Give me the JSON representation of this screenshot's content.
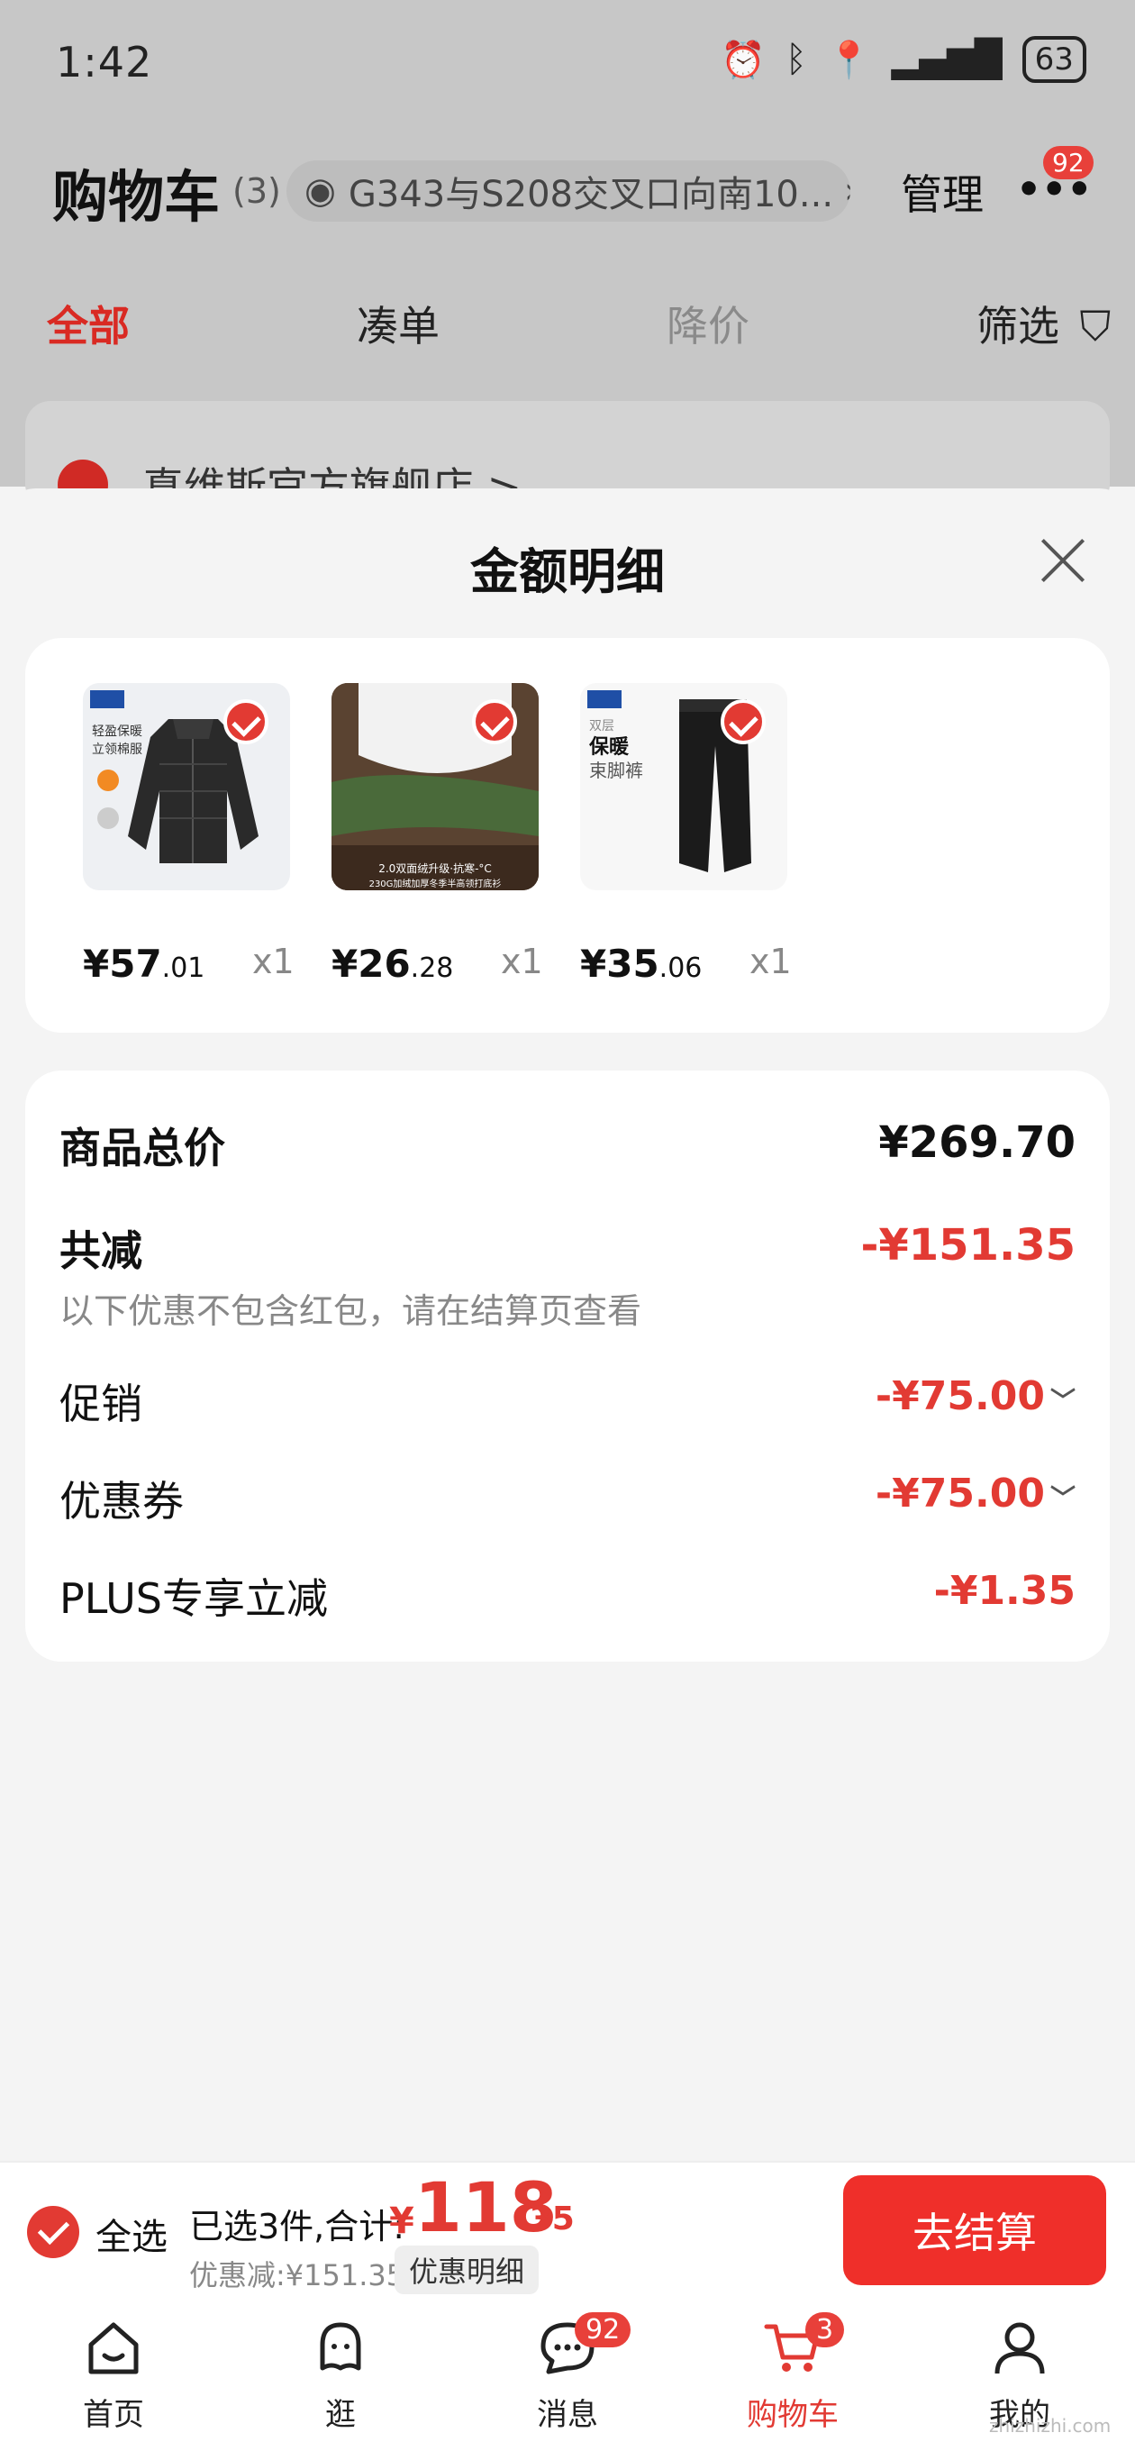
{
  "status_bar": {
    "time": "1:42",
    "battery": "63"
  },
  "header": {
    "title": "购物车",
    "count": "(3)",
    "address": "G343与S208交叉口向南10...",
    "manage": "管理",
    "more_badge": "92"
  },
  "tabs": [
    {
      "label": "全部"
    },
    {
      "label": "凑单"
    },
    {
      "label": "降价"
    },
    {
      "label": "筛选"
    }
  ],
  "store": {
    "name": "真维斯官方旗舰店 >"
  },
  "sheet": {
    "title": "金额明细",
    "items": [
      {
        "name": "轻盈保暖立领棉服",
        "price_int": "¥57",
        "price_dec": ".01",
        "qty": "x1"
      },
      {
        "name": "2.0双面绒升级·抗寒-°C 230G加绒加厚冬季半高领打底衫",
        "price_int": "¥26",
        "price_dec": ".28",
        "qty": "x1"
      },
      {
        "name": "双层 保暖 束脚裤",
        "price_int": "¥35",
        "price_dec": ".06",
        "qty": "x1"
      }
    ],
    "summary": {
      "total_label": "商品总价",
      "total_value": "¥269.70",
      "reduce_label": "共减",
      "reduce_value": "-¥151.35",
      "reduce_note": "以下优惠不包含红包，请在结算页查看",
      "promo_label": "促销",
      "promo_value": "-¥75.00",
      "coupon_label": "优惠券",
      "coupon_value": "-¥75.00",
      "plus_label": "PLUS专享立减",
      "plus_value": "-¥1.35"
    }
  },
  "checkout": {
    "select_all": "全选",
    "selected_text": "已选3件,合计:",
    "total_yen": "¥",
    "total_int": "118",
    "total_dec": ".35",
    "discount_text": "优惠减:¥151.35",
    "discount_btn": "优惠明细",
    "pay_btn": "去结算"
  },
  "nav": [
    {
      "label": "首页",
      "icon": "home-icon"
    },
    {
      "label": "逛",
      "icon": "browse-icon"
    },
    {
      "label": "消息",
      "icon": "message-icon",
      "badge": "92"
    },
    {
      "label": "购物车",
      "icon": "cart-icon",
      "badge": "3",
      "active": true
    },
    {
      "label": "我的",
      "icon": "profile-icon"
    }
  ],
  "watermark": "zhizhizhi.com",
  "colors": {
    "accent": "#e23a33",
    "dim": "#c7c7c7"
  }
}
